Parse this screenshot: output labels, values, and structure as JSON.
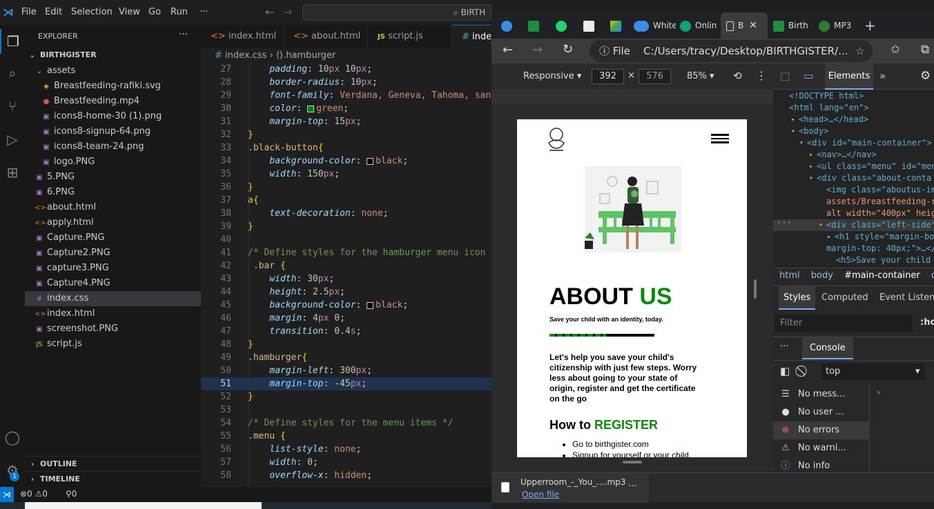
{
  "vscode": {
    "menu": [
      "File",
      "Edit",
      "Selection",
      "View",
      "Go",
      "Run",
      "···"
    ],
    "search_text": "BIRTH",
    "explorer_title": "EXPLORER",
    "explorer_more": "···",
    "root_folder": "BIRTHGISTER",
    "assets_folder": "assets",
    "asset_files": [
      "Breastfeeding-rafiki.svg",
      "Breastfeeding.mp4",
      "icons8-home-30 (1).png",
      "icons8-signup-64.png",
      "icons8-team-24.png",
      "logo.PNG"
    ],
    "root_files": [
      "5.PNG",
      "6.PNG",
      "about.html",
      "apply.html",
      "Capture.PNG",
      "Capture2.PNG",
      "capture3.PNG",
      "Capture4.PNG",
      "index.css",
      "index.html",
      "screenshot.PNG",
      "script.js"
    ],
    "outline_label": "OUTLINE",
    "timeline_label": "TIMELINE",
    "tabs": [
      "index.html",
      "about.html",
      "script.js",
      "inde"
    ],
    "breadcrumb": {
      "file": "index.css",
      "symbol": ".hamburger"
    },
    "code_lines": [
      {
        "n": "27",
        "t": [
          [
            "    ",
            "pl"
          ],
          [
            "padding",
            "prop"
          ],
          [
            ": ",
            "pl"
          ],
          [
            "10",
            "num"
          ],
          [
            "px",
            "unit"
          ],
          [
            " ",
            "pl"
          ],
          [
            "10",
            "num"
          ],
          [
            "px",
            "unit"
          ],
          [
            ";",
            "pl"
          ]
        ]
      },
      {
        "n": "28",
        "t": [
          [
            "    ",
            "pl"
          ],
          [
            "border-radius",
            "prop"
          ],
          [
            ": ",
            "pl"
          ],
          [
            "10",
            "num"
          ],
          [
            "px",
            "unit"
          ],
          [
            ";",
            "pl"
          ]
        ]
      },
      {
        "n": "29",
        "t": [
          [
            "    ",
            "pl"
          ],
          [
            "font-family",
            "prop"
          ],
          [
            ": ",
            "pl"
          ],
          [
            "Verdana, Geneva, Tahoma, sans",
            "val"
          ]
        ]
      },
      {
        "n": "30",
        "t": [
          [
            "    ",
            "pl"
          ],
          [
            "color",
            "prop"
          ],
          [
            ": ",
            "pl"
          ],
          [
            "■",
            "green"
          ],
          [
            "green",
            "val"
          ],
          [
            ";",
            "pl"
          ]
        ]
      },
      {
        "n": "31",
        "t": [
          [
            "    ",
            "pl"
          ],
          [
            "margin-top",
            "prop"
          ],
          [
            ": ",
            "pl"
          ],
          [
            "15",
            "num"
          ],
          [
            "px",
            "unit"
          ],
          [
            ";",
            "pl"
          ]
        ]
      },
      {
        "n": "32",
        "t": [
          [
            "}",
            "br"
          ]
        ]
      },
      {
        "n": "33",
        "t": [
          [
            ".black-button",
            "sel"
          ],
          [
            "{",
            "br"
          ]
        ]
      },
      {
        "n": "34",
        "t": [
          [
            "    ",
            "pl"
          ],
          [
            "background-color",
            "prop"
          ],
          [
            ": ",
            "pl"
          ],
          [
            "□",
            "white"
          ],
          [
            "black",
            "val"
          ],
          [
            ";",
            "pl"
          ]
        ]
      },
      {
        "n": "35",
        "t": [
          [
            "    ",
            "pl"
          ],
          [
            "width",
            "prop"
          ],
          [
            ": ",
            "pl"
          ],
          [
            "150",
            "num"
          ],
          [
            "px",
            "unit"
          ],
          [
            ";",
            "pl"
          ]
        ]
      },
      {
        "n": "36",
        "t": [
          [
            "}",
            "br"
          ]
        ]
      },
      {
        "n": "37",
        "t": [
          [
            "a",
            "sel"
          ],
          [
            "{",
            "br"
          ]
        ]
      },
      {
        "n": "38",
        "t": [
          [
            "    ",
            "pl"
          ],
          [
            "text-decoration",
            "prop"
          ],
          [
            ": ",
            "pl"
          ],
          [
            "none",
            "val"
          ],
          [
            ";",
            "pl"
          ]
        ]
      },
      {
        "n": "39",
        "t": [
          [
            "}",
            "br"
          ]
        ]
      },
      {
        "n": "40",
        "t": []
      },
      {
        "n": "41",
        "t": [
          [
            "/* Define styles for the hamburger menu icon *",
            "cm"
          ]
        ]
      },
      {
        "n": "42",
        "t": [
          [
            " .bar ",
            "sel"
          ],
          [
            "{",
            "br"
          ]
        ]
      },
      {
        "n": "43",
        "t": [
          [
            "    ",
            "pl"
          ],
          [
            "width",
            "prop"
          ],
          [
            ": ",
            "pl"
          ],
          [
            "30",
            "num"
          ],
          [
            "px",
            "unit"
          ],
          [
            ";",
            "pl"
          ]
        ]
      },
      {
        "n": "44",
        "t": [
          [
            "    ",
            "pl"
          ],
          [
            "height",
            "prop"
          ],
          [
            ": ",
            "pl"
          ],
          [
            "2.5",
            "num"
          ],
          [
            "px",
            "unit"
          ],
          [
            ";",
            "pl"
          ]
        ]
      },
      {
        "n": "45",
        "t": [
          [
            "    ",
            "pl"
          ],
          [
            "background-color",
            "prop"
          ],
          [
            ": ",
            "pl"
          ],
          [
            "□",
            "white"
          ],
          [
            "black",
            "val"
          ],
          [
            ";",
            "pl"
          ]
        ]
      },
      {
        "n": "46",
        "t": [
          [
            "    ",
            "pl"
          ],
          [
            "margin",
            "prop"
          ],
          [
            ": ",
            "pl"
          ],
          [
            "4",
            "num"
          ],
          [
            "px",
            "unit"
          ],
          [
            " ",
            "pl"
          ],
          [
            "0",
            "num"
          ],
          [
            ";",
            "pl"
          ]
        ]
      },
      {
        "n": "47",
        "t": [
          [
            "    ",
            "pl"
          ],
          [
            "transition",
            "prop"
          ],
          [
            ": ",
            "pl"
          ],
          [
            "0.4",
            "num"
          ],
          [
            "s",
            "unit"
          ],
          [
            ";",
            "pl"
          ]
        ]
      },
      {
        "n": "48",
        "t": [
          [
            "}",
            "br"
          ]
        ]
      },
      {
        "n": "49",
        "t": [
          [
            ".hamburger",
            "sel"
          ],
          [
            "{",
            "br"
          ]
        ]
      },
      {
        "n": "50",
        "t": [
          [
            "    ",
            "pl"
          ],
          [
            "margin-left",
            "prop"
          ],
          [
            ": ",
            "pl"
          ],
          [
            "300",
            "num"
          ],
          [
            "px",
            "unit"
          ],
          [
            ";",
            "pl"
          ]
        ]
      },
      {
        "n": "51",
        "t": [
          [
            "    ",
            "pl"
          ],
          [
            "margin-top",
            "prop"
          ],
          [
            ": ",
            "pl"
          ],
          [
            "-45",
            "num"
          ],
          [
            "px",
            "unit"
          ],
          [
            ";",
            "pl"
          ]
        ]
      },
      {
        "n": "52",
        "t": [
          [
            "}",
            "br"
          ]
        ]
      },
      {
        "n": "53",
        "t": []
      },
      {
        "n": "54",
        "t": [
          [
            "/* Define styles for the menu items */",
            "cm"
          ]
        ]
      },
      {
        "n": "55",
        "t": [
          [
            ".menu ",
            "sel"
          ],
          [
            "{",
            "br"
          ]
        ]
      },
      {
        "n": "56",
        "t": [
          [
            "    ",
            "pl"
          ],
          [
            "list-style",
            "prop"
          ],
          [
            ": ",
            "pl"
          ],
          [
            "none",
            "val"
          ],
          [
            ";",
            "pl"
          ]
        ]
      },
      {
        "n": "57",
        "t": [
          [
            "    ",
            "pl"
          ],
          [
            "width",
            "prop"
          ],
          [
            ": ",
            "pl"
          ],
          [
            "0",
            "num"
          ],
          [
            ";",
            "pl"
          ]
        ]
      },
      {
        "n": "58",
        "t": [
          [
            "    ",
            "pl"
          ],
          [
            "overflow-x",
            "prop"
          ],
          [
            ": ",
            "pl"
          ],
          [
            "hidden",
            "val"
          ],
          [
            ";",
            "pl"
          ]
        ]
      }
    ],
    "status": {
      "errors": "0",
      "warnings": "0",
      "ports": "0",
      "badge": "1"
    }
  },
  "browser": {
    "tabs": [
      "",
      "",
      "",
      "",
      "",
      "",
      "White",
      "Onlin",
      "B",
      "Birth",
      "MP3"
    ],
    "new_tab": "+",
    "address_file": "File",
    "address_url": "C:/Users/tracy/Desktop/BIRTHGISTER/...",
    "responsive_label": "Responsive",
    "width": "392",
    "x": "×",
    "height": "576",
    "zoom": "85%",
    "page": {
      "heading_black": "ABOUT ",
      "heading_green": "US",
      "tagline": "Save your child with an identity, today.",
      "body": "Let's help you save your child's citizenship with just few steps. Worry less about going to your state of origin, register and get the certificate on the go",
      "how_black": "How to ",
      "how_green": "REGISTER",
      "steps": [
        "Go to birthgister.com",
        "Signup for yourself or your child"
      ],
      "accent": "#0a8a0a"
    },
    "download": {
      "file": "Upperroom_-_You_....mp3",
      "action": "Open file",
      "more": "···"
    }
  },
  "devtools": {
    "elements_tab": "Elements",
    "more": "»",
    "dom_lines": [
      "<!DOCTYPE html>",
      "<html lang=\"en\">",
      "<head>…</head>",
      "<body>",
      "<div id=\"main-container\">",
      "<nav>…</nav>",
      "<ul class=\"menu\" id=\"men",
      "<div class=\"about-conta",
      "<img class=\"aboutus-im",
      "assets/Breastfeeding-r",
      "alt width=\"400px\" heig",
      "<div class=\"left-side\"",
      "<h1 style=\"margin-bo",
      "margin-top: 40px;\">…</",
      "<h5>Save your child w"
    ],
    "crumbs": [
      "html",
      "body",
      "#main-container",
      "div"
    ],
    "style_tabs": [
      "Styles",
      "Computed",
      "Event Listener"
    ],
    "filter_placeholder": "Filter",
    "filter_hov": ":ho",
    "console_tab": "Console",
    "console_more": "···",
    "context": "top",
    "console_filters": [
      "No mess...",
      "No user ...",
      "No errors",
      "No warni...",
      "No info"
    ]
  }
}
